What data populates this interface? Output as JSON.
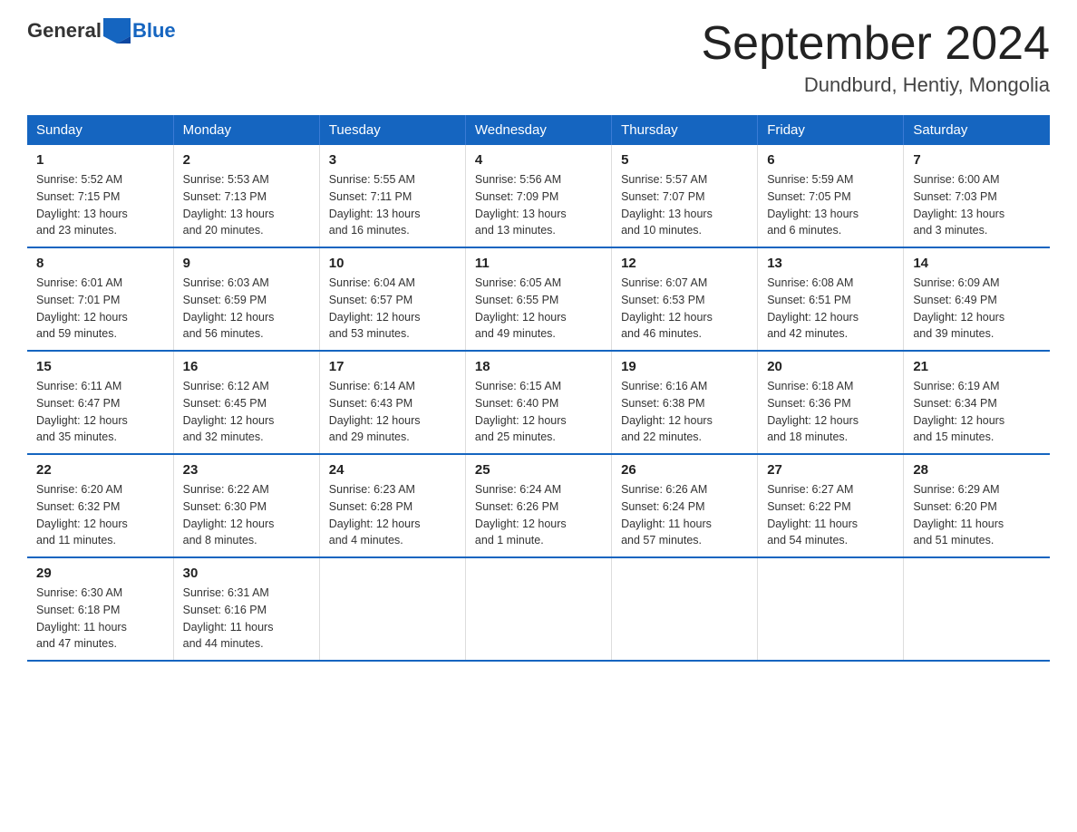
{
  "logo": {
    "general": "General",
    "blue": "Blue"
  },
  "title": "September 2024",
  "subtitle": "Dundburd, Hentiy, Mongolia",
  "weekdays": [
    "Sunday",
    "Monday",
    "Tuesday",
    "Wednesday",
    "Thursday",
    "Friday",
    "Saturday"
  ],
  "weeks": [
    [
      {
        "day": "1",
        "info": "Sunrise: 5:52 AM\nSunset: 7:15 PM\nDaylight: 13 hours\nand 23 minutes."
      },
      {
        "day": "2",
        "info": "Sunrise: 5:53 AM\nSunset: 7:13 PM\nDaylight: 13 hours\nand 20 minutes."
      },
      {
        "day": "3",
        "info": "Sunrise: 5:55 AM\nSunset: 7:11 PM\nDaylight: 13 hours\nand 16 minutes."
      },
      {
        "day": "4",
        "info": "Sunrise: 5:56 AM\nSunset: 7:09 PM\nDaylight: 13 hours\nand 13 minutes."
      },
      {
        "day": "5",
        "info": "Sunrise: 5:57 AM\nSunset: 7:07 PM\nDaylight: 13 hours\nand 10 minutes."
      },
      {
        "day": "6",
        "info": "Sunrise: 5:59 AM\nSunset: 7:05 PM\nDaylight: 13 hours\nand 6 minutes."
      },
      {
        "day": "7",
        "info": "Sunrise: 6:00 AM\nSunset: 7:03 PM\nDaylight: 13 hours\nand 3 minutes."
      }
    ],
    [
      {
        "day": "8",
        "info": "Sunrise: 6:01 AM\nSunset: 7:01 PM\nDaylight: 12 hours\nand 59 minutes."
      },
      {
        "day": "9",
        "info": "Sunrise: 6:03 AM\nSunset: 6:59 PM\nDaylight: 12 hours\nand 56 minutes."
      },
      {
        "day": "10",
        "info": "Sunrise: 6:04 AM\nSunset: 6:57 PM\nDaylight: 12 hours\nand 53 minutes."
      },
      {
        "day": "11",
        "info": "Sunrise: 6:05 AM\nSunset: 6:55 PM\nDaylight: 12 hours\nand 49 minutes."
      },
      {
        "day": "12",
        "info": "Sunrise: 6:07 AM\nSunset: 6:53 PM\nDaylight: 12 hours\nand 46 minutes."
      },
      {
        "day": "13",
        "info": "Sunrise: 6:08 AM\nSunset: 6:51 PM\nDaylight: 12 hours\nand 42 minutes."
      },
      {
        "day": "14",
        "info": "Sunrise: 6:09 AM\nSunset: 6:49 PM\nDaylight: 12 hours\nand 39 minutes."
      }
    ],
    [
      {
        "day": "15",
        "info": "Sunrise: 6:11 AM\nSunset: 6:47 PM\nDaylight: 12 hours\nand 35 minutes."
      },
      {
        "day": "16",
        "info": "Sunrise: 6:12 AM\nSunset: 6:45 PM\nDaylight: 12 hours\nand 32 minutes."
      },
      {
        "day": "17",
        "info": "Sunrise: 6:14 AM\nSunset: 6:43 PM\nDaylight: 12 hours\nand 29 minutes."
      },
      {
        "day": "18",
        "info": "Sunrise: 6:15 AM\nSunset: 6:40 PM\nDaylight: 12 hours\nand 25 minutes."
      },
      {
        "day": "19",
        "info": "Sunrise: 6:16 AM\nSunset: 6:38 PM\nDaylight: 12 hours\nand 22 minutes."
      },
      {
        "day": "20",
        "info": "Sunrise: 6:18 AM\nSunset: 6:36 PM\nDaylight: 12 hours\nand 18 minutes."
      },
      {
        "day": "21",
        "info": "Sunrise: 6:19 AM\nSunset: 6:34 PM\nDaylight: 12 hours\nand 15 minutes."
      }
    ],
    [
      {
        "day": "22",
        "info": "Sunrise: 6:20 AM\nSunset: 6:32 PM\nDaylight: 12 hours\nand 11 minutes."
      },
      {
        "day": "23",
        "info": "Sunrise: 6:22 AM\nSunset: 6:30 PM\nDaylight: 12 hours\nand 8 minutes."
      },
      {
        "day": "24",
        "info": "Sunrise: 6:23 AM\nSunset: 6:28 PM\nDaylight: 12 hours\nand 4 minutes."
      },
      {
        "day": "25",
        "info": "Sunrise: 6:24 AM\nSunset: 6:26 PM\nDaylight: 12 hours\nand 1 minute."
      },
      {
        "day": "26",
        "info": "Sunrise: 6:26 AM\nSunset: 6:24 PM\nDaylight: 11 hours\nand 57 minutes."
      },
      {
        "day": "27",
        "info": "Sunrise: 6:27 AM\nSunset: 6:22 PM\nDaylight: 11 hours\nand 54 minutes."
      },
      {
        "day": "28",
        "info": "Sunrise: 6:29 AM\nSunset: 6:20 PM\nDaylight: 11 hours\nand 51 minutes."
      }
    ],
    [
      {
        "day": "29",
        "info": "Sunrise: 6:30 AM\nSunset: 6:18 PM\nDaylight: 11 hours\nand 47 minutes."
      },
      {
        "day": "30",
        "info": "Sunrise: 6:31 AM\nSunset: 6:16 PM\nDaylight: 11 hours\nand 44 minutes."
      },
      {
        "day": "",
        "info": ""
      },
      {
        "day": "",
        "info": ""
      },
      {
        "day": "",
        "info": ""
      },
      {
        "day": "",
        "info": ""
      },
      {
        "day": "",
        "info": ""
      }
    ]
  ]
}
